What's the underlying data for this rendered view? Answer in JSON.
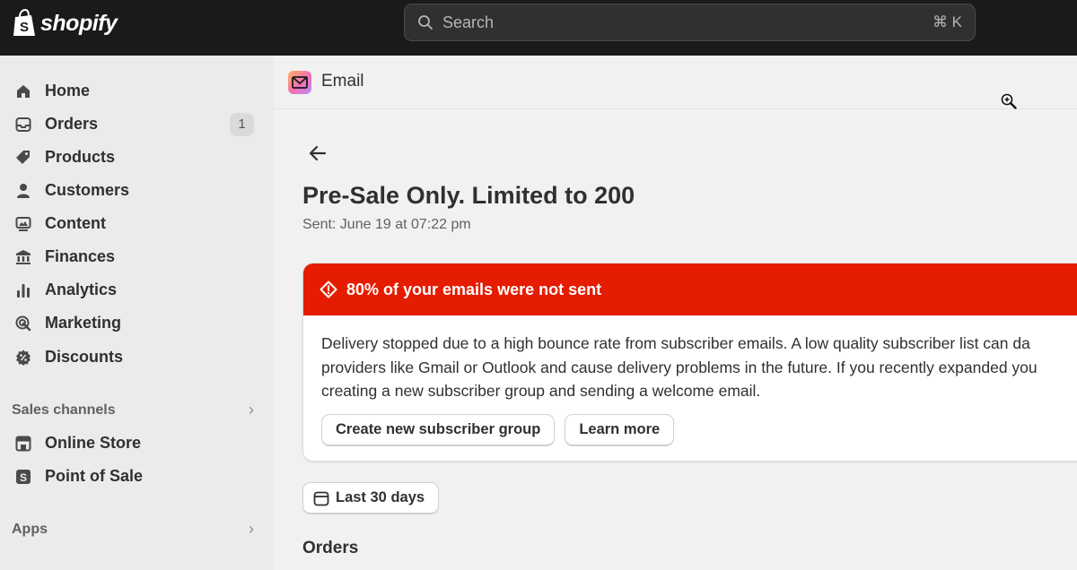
{
  "topbar": {
    "brand": "shopify",
    "search_placeholder": "Search",
    "search_shortcut": "⌘ K"
  },
  "sidebar": {
    "items": [
      {
        "label": "Home",
        "icon": "home-icon"
      },
      {
        "label": "Orders",
        "icon": "orders-icon",
        "badge": "1"
      },
      {
        "label": "Products",
        "icon": "tag-icon"
      },
      {
        "label": "Customers",
        "icon": "person-icon"
      },
      {
        "label": "Content",
        "icon": "content-icon"
      },
      {
        "label": "Finances",
        "icon": "bank-icon"
      },
      {
        "label": "Analytics",
        "icon": "bar-chart-icon"
      },
      {
        "label": "Marketing",
        "icon": "target-icon"
      },
      {
        "label": "Discounts",
        "icon": "discount-icon"
      }
    ],
    "sales_channels": {
      "label": "Sales channels",
      "items": [
        {
          "label": "Online Store",
          "icon": "store-icon"
        },
        {
          "label": "Point of Sale",
          "icon": "pos-icon"
        }
      ]
    },
    "apps": {
      "label": "Apps"
    }
  },
  "app_header": {
    "title": "Email",
    "icon": "email-app-icon"
  },
  "page": {
    "title": "Pre-Sale Only. Limited to 200",
    "sent": "Sent: June 19 at 07:22 pm"
  },
  "alert": {
    "title": "80% of your emails were not sent",
    "lines": [
      "Delivery stopped due to a high bounce rate from subscriber emails. A low quality subscriber list can da",
      "providers like Gmail or Outlook and cause delivery problems in the future. If you recently expanded you",
      "creating a new subscriber group and sending a welcome email."
    ],
    "primary_action": "Create new subscriber group",
    "secondary_action": "Learn more",
    "color": "#e51c00"
  },
  "filters": {
    "date_range": "Last 30 days"
  },
  "sections": {
    "orders": "Orders"
  }
}
